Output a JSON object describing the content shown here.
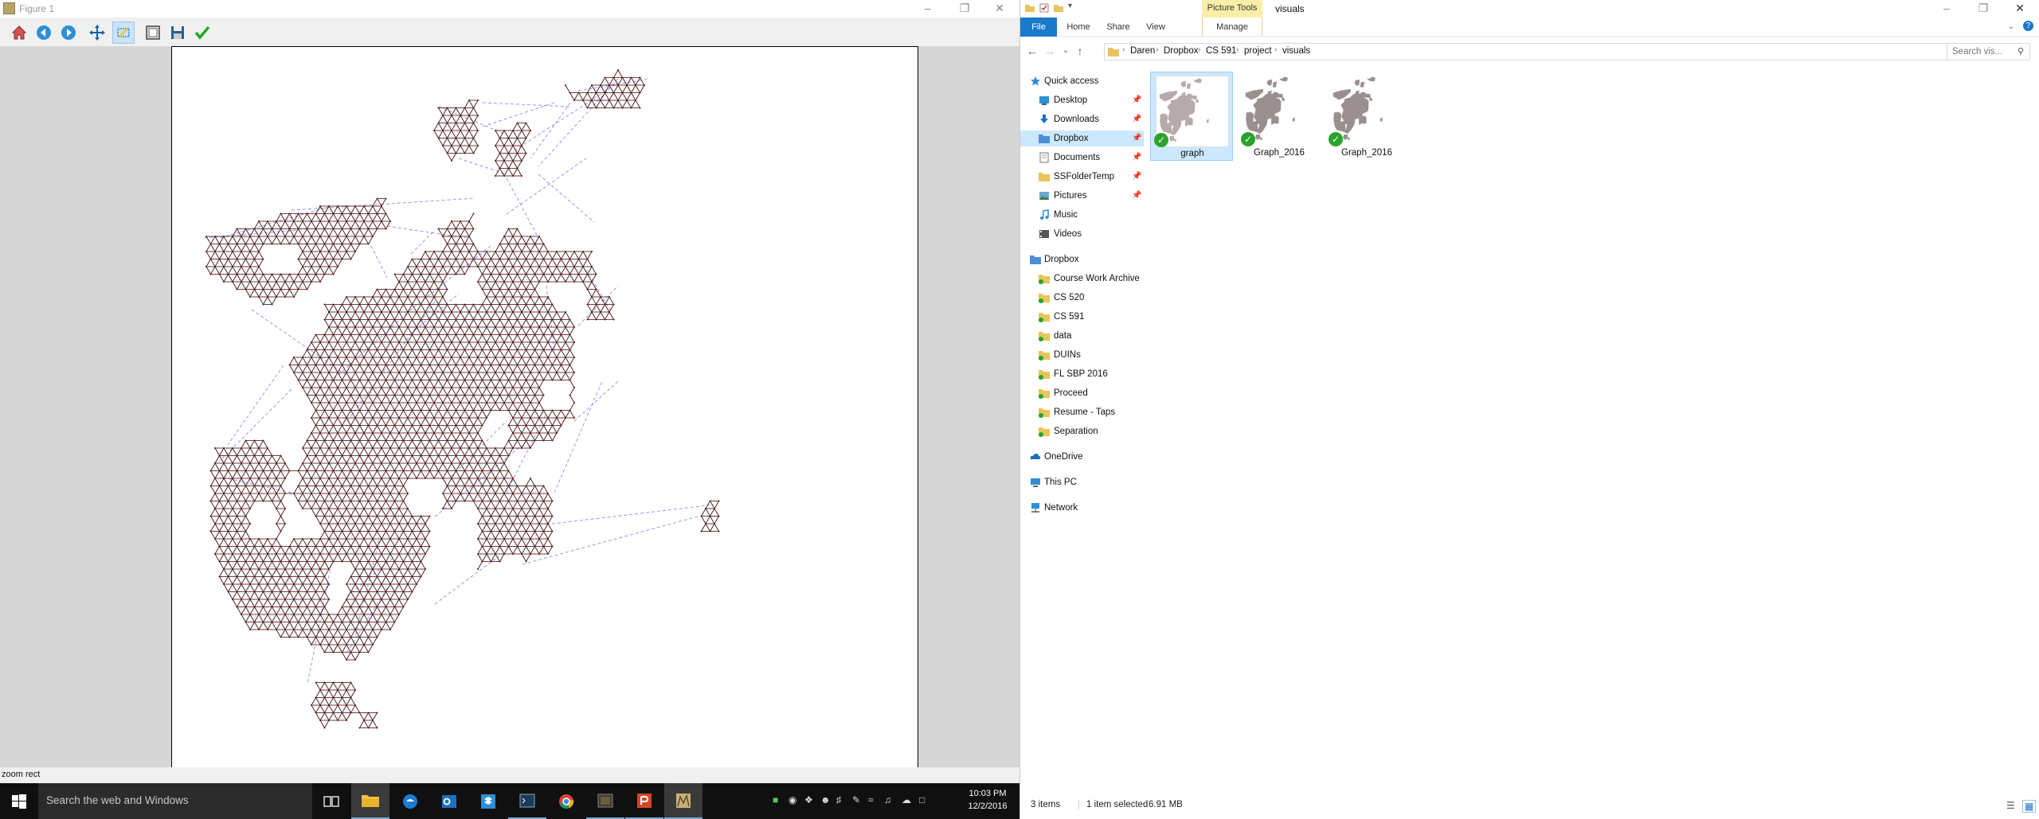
{
  "figure": {
    "title": "Figure 1",
    "toolbar": [
      {
        "name": "home-icon",
        "color": "#d9534f"
      },
      {
        "name": "back-icon",
        "color": "#2f8fd6"
      },
      {
        "name": "forward-icon",
        "color": "#2f8fd6"
      },
      {
        "name": "pan-icon",
        "color": "#1a5fa8"
      },
      {
        "name": "zoom-icon",
        "color": "#2f8fd6"
      },
      {
        "name": "subplots-icon",
        "color": "#444444"
      },
      {
        "name": "save-icon",
        "color": "#2a5f8a"
      },
      {
        "name": "edit-check-icon",
        "color": "#22aa22"
      }
    ],
    "active_tool": "zoom-icon",
    "status": "zoom rect",
    "plot_colors": {
      "nodes": "#8b0000",
      "solid_edges": "#2a0505",
      "dashed_edges": "#6666ee"
    }
  },
  "explorer": {
    "title": "visuals",
    "context_tab": "Picture Tools",
    "ribbon_tabs": [
      "File",
      "Home",
      "Share",
      "View",
      "Manage"
    ],
    "breadcrumb": [
      "Daren",
      "Dropbox",
      "CS 591",
      "project",
      "visuals"
    ],
    "search_placeholder": "Search vis...",
    "nav": {
      "quick_access_label": "Quick access",
      "quick_access": [
        {
          "label": "Desktop",
          "icon": "desktop-icon"
        },
        {
          "label": "Downloads",
          "icon": "downloads-icon"
        },
        {
          "label": "Dropbox",
          "icon": "dropbox-icon"
        },
        {
          "label": "Documents",
          "icon": "documents-icon"
        },
        {
          "label": "SSFolderTemp",
          "icon": "folder-icon"
        },
        {
          "label": "Pictures",
          "icon": "pictures-icon"
        },
        {
          "label": "Music",
          "icon": "music-icon"
        },
        {
          "label": "Videos",
          "icon": "videos-icon"
        }
      ],
      "dropbox_label": "Dropbox",
      "dropbox_items": [
        "Course Work Archive",
        "CS 520",
        "CS 591",
        "data",
        "DUINs",
        "FL SBP 2016",
        "Proceed",
        "Resume - Taps",
        "Separation"
      ],
      "other": [
        {
          "label": "OneDrive",
          "icon": "onedrive-icon"
        },
        {
          "label": "This PC",
          "icon": "pc-icon"
        },
        {
          "label": "Network",
          "icon": "network-icon"
        }
      ]
    },
    "files": [
      {
        "name": "graph",
        "selected": true
      },
      {
        "name": "Graph_2016",
        "selected": false
      },
      {
        "name": "Graph_2016",
        "selected": false
      }
    ],
    "status": {
      "count": "3 items",
      "selection": "1 item selected",
      "size": "6.91 MB"
    }
  },
  "taskbar": {
    "search_placeholder": "Search the web and Windows",
    "apps": [
      "task-view-icon",
      "file-explorer-icon",
      "edge-icon",
      "outlook-icon",
      "dropbox-app-icon",
      "terminal-icon",
      "chrome-icon",
      "media-icon",
      "powerpoint-icon",
      "matplotlib-icon"
    ],
    "time": "10:03 PM",
    "date": "12/2/2016"
  }
}
